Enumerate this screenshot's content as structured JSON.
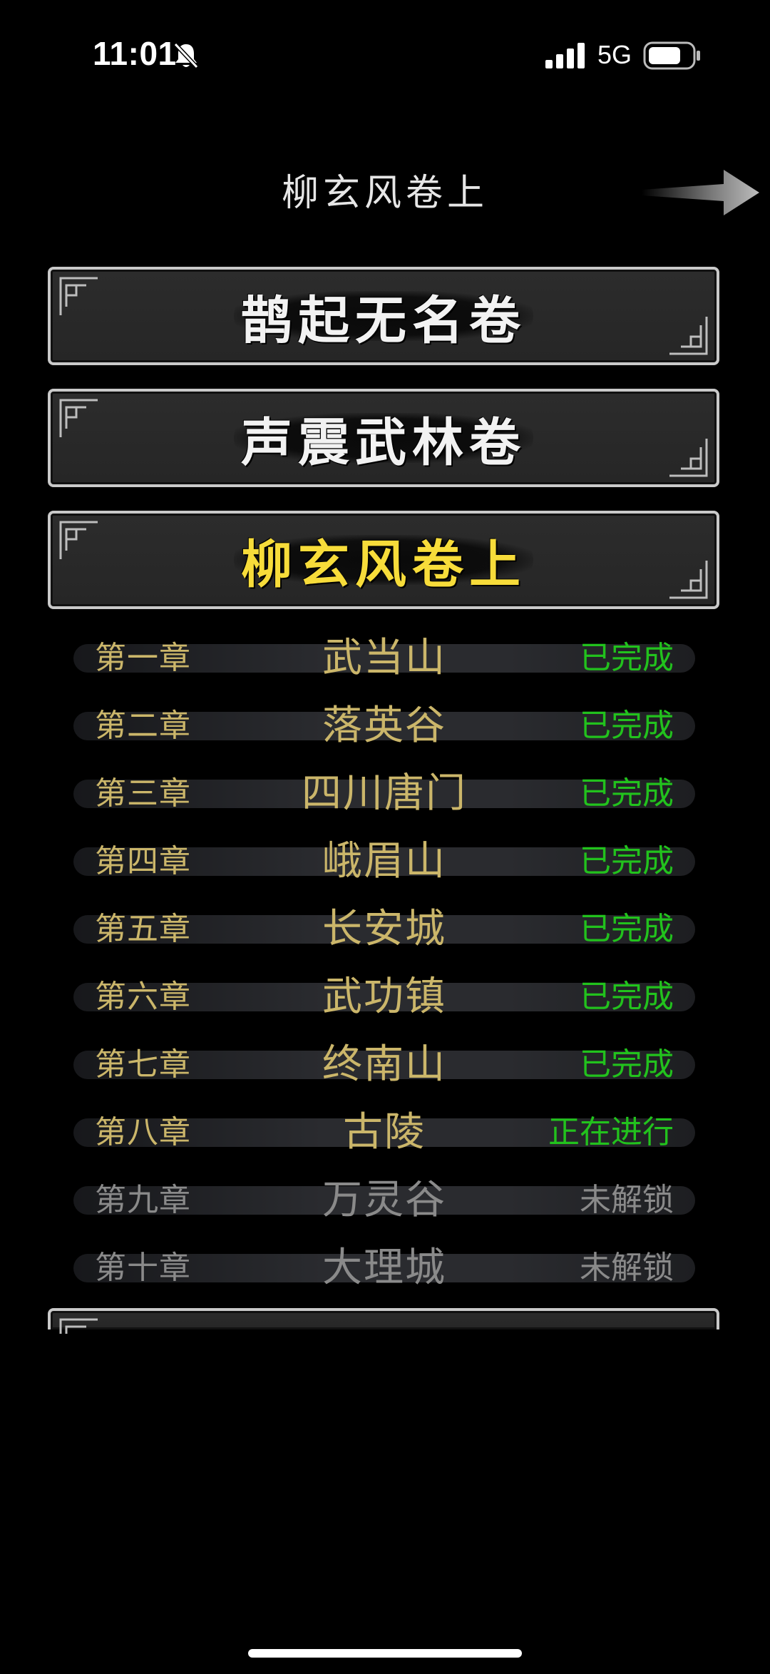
{
  "status_bar": {
    "time": "11:01",
    "network": "5G",
    "icons": [
      "bell-slash-icon",
      "signal-icon",
      "battery-icon"
    ]
  },
  "header": {
    "title": "柳玄风卷上",
    "next_icon": "arrow-right-icon"
  },
  "volumes": [
    {
      "label": "鹊起无名卷",
      "selected": false
    },
    {
      "label": "声震武林卷",
      "selected": false
    },
    {
      "label": "柳玄风卷上",
      "selected": true
    }
  ],
  "chapters": [
    {
      "num": "第一章",
      "name": "武当山",
      "status": "已完成"
    },
    {
      "num": "第二章",
      "name": "落英谷",
      "status": "已完成"
    },
    {
      "num": "第三章",
      "name": "四川唐门",
      "status": "已完成"
    },
    {
      "num": "第四章",
      "name": "峨眉山",
      "status": "已完成"
    },
    {
      "num": "第五章",
      "name": "长安城",
      "status": "已完成"
    },
    {
      "num": "第六章",
      "name": "武功镇",
      "status": "已完成"
    },
    {
      "num": "第七章",
      "name": "终南山",
      "status": "已完成"
    },
    {
      "num": "第八章",
      "name": "古陵",
      "status": "正在进行"
    },
    {
      "num": "第九章",
      "name": "万灵谷",
      "status": "未解锁"
    },
    {
      "num": "第十章",
      "name": "大理城",
      "status": "未解锁"
    }
  ],
  "colors": {
    "selected_volume": "#f7dc3a",
    "chapter_text": "#cbb66a",
    "status_active": "#22c21d",
    "status_locked": "#8a8a8a"
  }
}
